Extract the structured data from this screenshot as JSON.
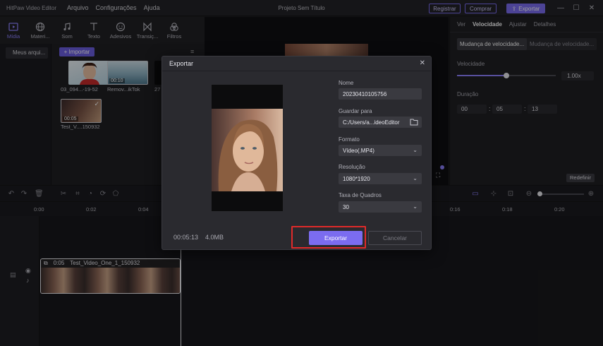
{
  "app": {
    "name": "HitPaw Video Editor",
    "document_title": "Projeto Sem Título",
    "menu": [
      "Arquivo",
      "Configurações",
      "Ajuda"
    ],
    "buttons": {
      "registrar": "Registrar",
      "comprar": "Comprar",
      "exportar": "Exportar"
    }
  },
  "media_tabs": [
    {
      "label": "Mídia",
      "icon": "media-icon",
      "active": true
    },
    {
      "label": "Materi...",
      "icon": "globe-icon"
    },
    {
      "label": "Som",
      "icon": "music-note-icon"
    },
    {
      "label": "Texto",
      "icon": "text-icon"
    },
    {
      "label": "Adesivos",
      "icon": "sticker-icon"
    },
    {
      "label": "Transiç...",
      "icon": "transition-icon"
    },
    {
      "label": "Filtros",
      "icon": "filter-icon"
    }
  ],
  "media_sidebar": {
    "item": "Meus arqui..."
  },
  "media_area": {
    "import_label": "+ Importar",
    "thumbs": [
      {
        "label": "03_094...-19-52",
        "duration": ""
      },
      {
        "label": "Remov...ikTok",
        "duration": "00:10"
      },
      {
        "label": "27",
        "duration": ""
      },
      {
        "label": "Test_V....150932",
        "duration": "00:05"
      }
    ]
  },
  "props": {
    "tabs": [
      "Ver",
      "Velocidade",
      "Ajustar",
      "Detalhes"
    ],
    "active_tab": "Velocidade",
    "speed_modes": [
      "Mudança de velocidade...",
      "Mudança de velocidade..."
    ],
    "speed_label": "Velocidade",
    "speed_value": "1.00x",
    "speed_slider_fraction": 0.5,
    "duration_label": "Duração",
    "duration": [
      "00",
      "05",
      "13"
    ],
    "reset_label": "Redefinir"
  },
  "ruler": [
    "0:00",
    "0:02",
    "0:04",
    "0:16",
    "0:18",
    "0:20"
  ],
  "clip": {
    "duration": "0:05",
    "name": "Test_Video_One_1_150932"
  },
  "export_dialog": {
    "title": "Exportar",
    "name_label": "Nome",
    "name_value": "20230410105756",
    "save_label": "Guardar para",
    "save_value": "C:/Users/a...ideoEditor",
    "format_label": "Formato",
    "format_value": "Vídeo(.MP4)",
    "resolution_label": "Resolução",
    "resolution_value": "1080*1920",
    "fps_label": "Taxa de Quadros",
    "fps_value": "30",
    "duration": "00:05:13",
    "size": "4.0MB",
    "export_label": "Exportar",
    "cancel_label": "Cancelar"
  },
  "colors": {
    "accent": "#7b6cf0",
    "highlight": "#e02a2a"
  }
}
